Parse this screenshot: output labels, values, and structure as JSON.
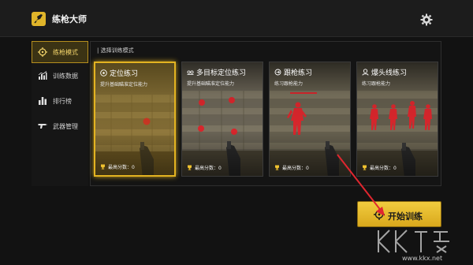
{
  "app": {
    "title": "练枪大师",
    "logo_icon": "rocket-icon",
    "settings_icon": "gear-icon"
  },
  "sidebar": {
    "items": [
      {
        "label": "练枪模式",
        "icon": "crosshair-icon",
        "active": true
      },
      {
        "label": "训练数据",
        "icon": "bar-chart-icon",
        "active": false
      },
      {
        "label": "排行榜",
        "icon": "leaderboard-icon",
        "active": false
      },
      {
        "label": "武器管理",
        "icon": "gun-icon",
        "active": false
      }
    ]
  },
  "panel": {
    "title": "| 选择训练模式",
    "cards": [
      {
        "title": "定位练习",
        "icon": "target-icon",
        "description": "提升基础瞄准定位能力",
        "score": "最高分数：0",
        "selected": true
      },
      {
        "title": "多目标定位练习",
        "icon": "multi-target-icon",
        "description": "提升基础瞄准定位能力",
        "score": "最高分数：0",
        "selected": false
      },
      {
        "title": "跟枪练习",
        "icon": "track-icon",
        "description": "练习跟枪能力",
        "score": "最高分数：0",
        "selected": false
      },
      {
        "title": "爆头线练习",
        "icon": "head-icon",
        "description": "练习跟枪能力",
        "score": "最高分数：0",
        "selected": false
      }
    ]
  },
  "start_button": {
    "label": "开始训练",
    "icon": "crosshair-icon"
  },
  "watermark": {
    "text": "www.kkx.net"
  },
  "colors": {
    "accent": "#e3b321",
    "background": "#121212",
    "target": "#d8262c",
    "annotation_arrow": "#e0262f"
  }
}
